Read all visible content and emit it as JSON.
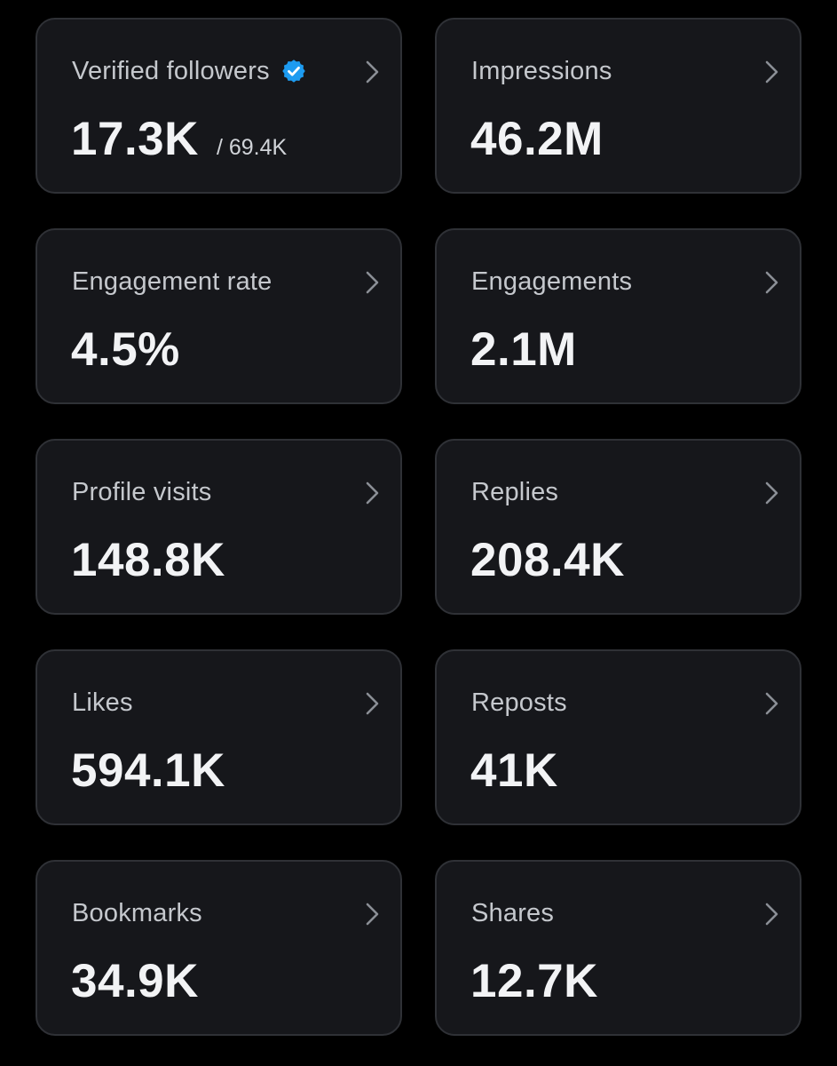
{
  "colors": {
    "background": "#000000",
    "card": "#16171b",
    "card_border": "#2f3136",
    "label": "#c5c8cd",
    "value": "#f2f3f5",
    "verified_badge": "#1d9bf0",
    "chevron": "#8b8f96"
  },
  "icons": {
    "verified": "verified-badge-icon",
    "chevron": "chevron-right-icon"
  },
  "cards": [
    {
      "label": "Verified followers",
      "value": "17.3K",
      "sub": "/ 69.4K"
    },
    {
      "label": "Impressions",
      "value": "46.2M"
    },
    {
      "label": "Engagement rate",
      "value": "4.5%"
    },
    {
      "label": "Engagements",
      "value": "2.1M"
    },
    {
      "label": "Profile visits",
      "value": "148.8K"
    },
    {
      "label": "Replies",
      "value": "208.4K"
    },
    {
      "label": "Likes",
      "value": "594.1K"
    },
    {
      "label": "Reposts",
      "value": "41K"
    },
    {
      "label": "Bookmarks",
      "value": "34.9K"
    },
    {
      "label": "Shares",
      "value": "12.7K"
    }
  ]
}
